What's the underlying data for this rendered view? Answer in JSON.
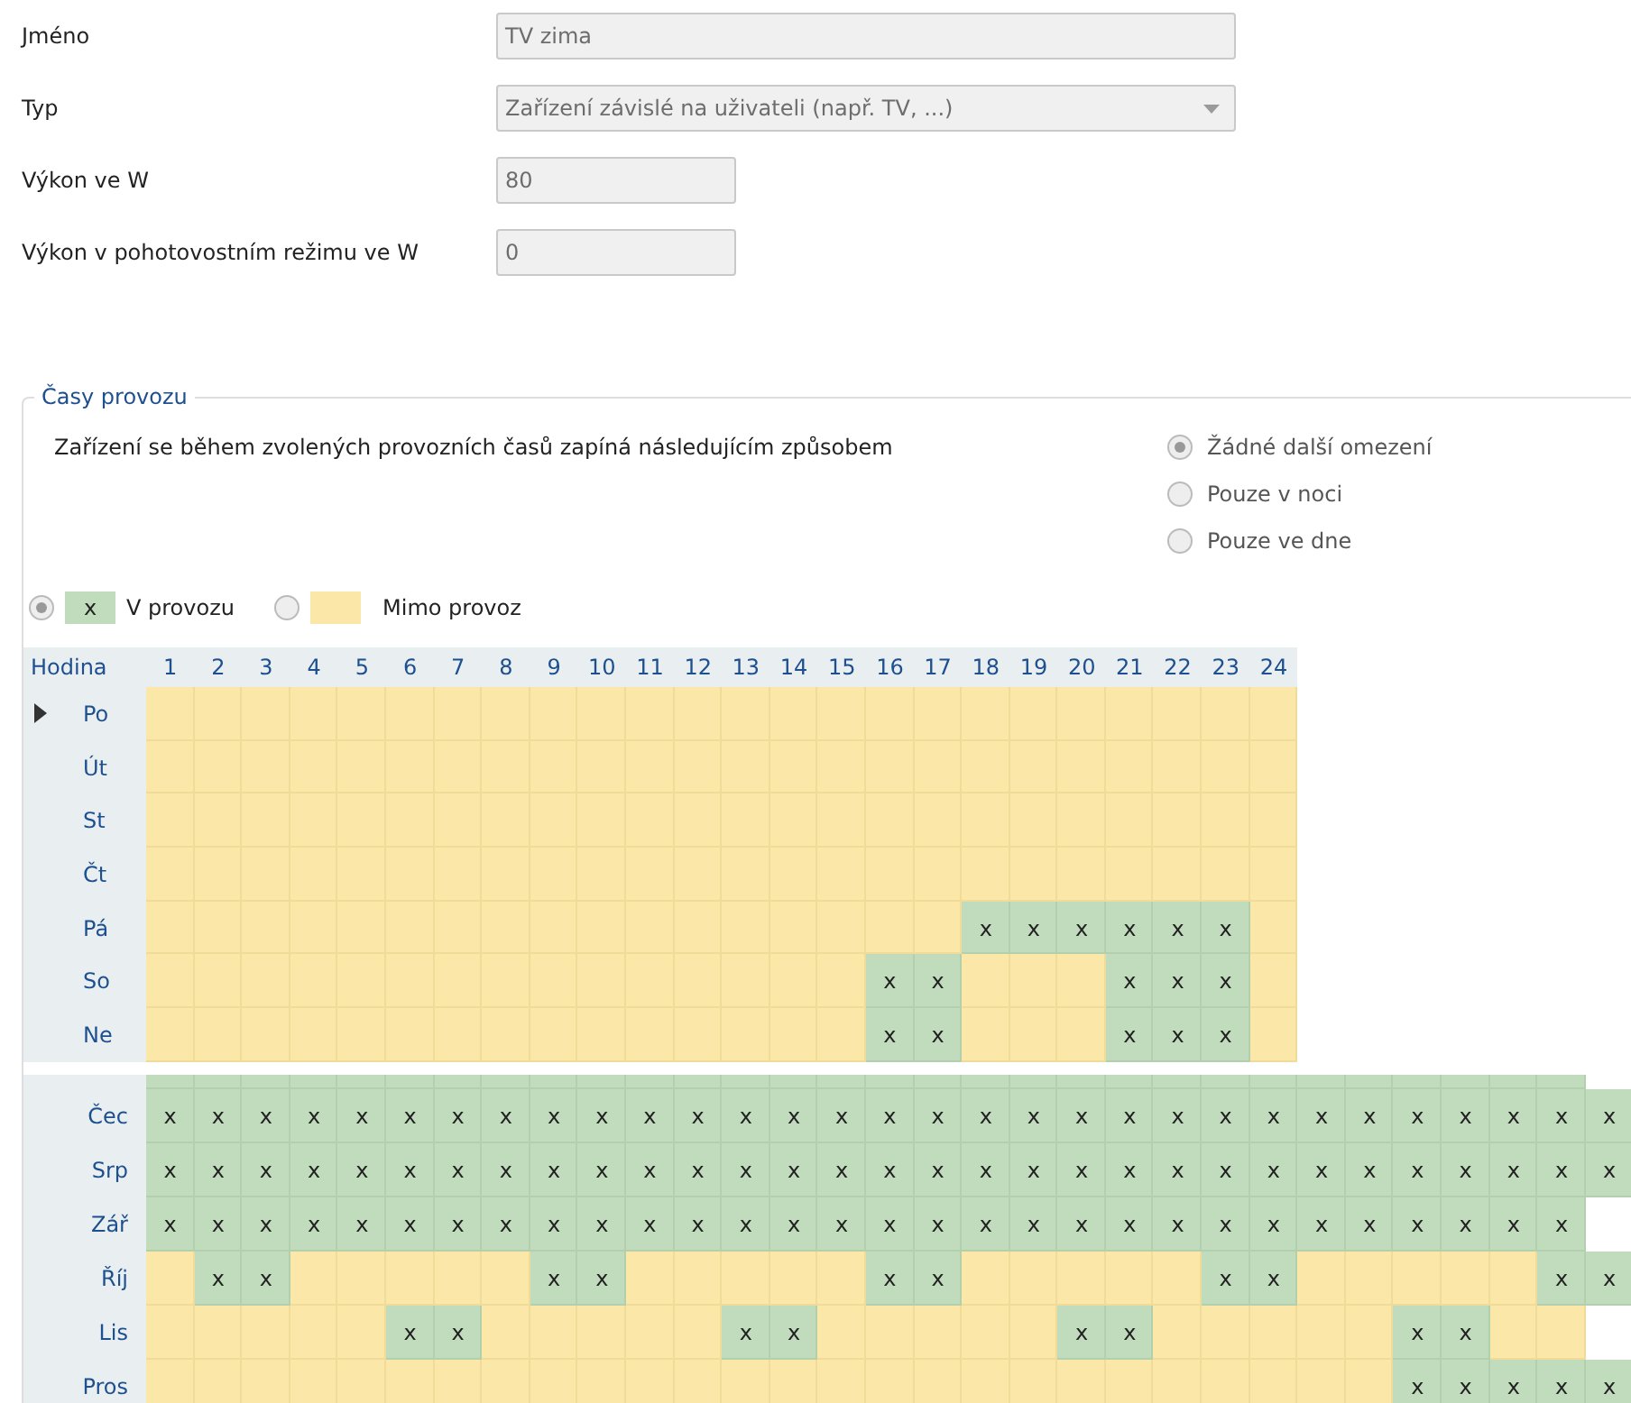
{
  "form": [
    {
      "label": "Jméno",
      "kind": "text",
      "value": "TV zima"
    },
    {
      "label": "Typ",
      "kind": "select",
      "value": "Zařízení závislé na uživateli (např. TV, ...)"
    },
    {
      "label": "Výkon ve W",
      "kind": "number",
      "value": "80"
    },
    {
      "label": "Výkon v pohotovostním režimu ve W",
      "kind": "number",
      "value": "0"
    }
  ],
  "operating_times": {
    "title": "Časy provozu",
    "description": "Zařízení se během zvolených provozních časů zapíná následujícím způsobem",
    "options": [
      {
        "label": "Žádné další omezení",
        "selected": true
      },
      {
        "label": "Pouze v noci",
        "selected": false
      },
      {
        "label": "Pouze ve dne",
        "selected": false
      }
    ],
    "legend": [
      {
        "label": "V provozu",
        "on": true,
        "mark": "x",
        "selected": true
      },
      {
        "label": "Mimo provoz",
        "on": false,
        "selected": false
      }
    ],
    "week_grid": {
      "corner": "Hodina",
      "columns": [
        "1",
        "2",
        "3",
        "4",
        "5",
        "6",
        "7",
        "8",
        "9",
        "10",
        "11",
        "12",
        "13",
        "14",
        "15",
        "16",
        "17",
        "18",
        "19",
        "20",
        "21",
        "22",
        "23",
        "24"
      ],
      "rows": [
        {
          "label": "Po",
          "current": true,
          "cells": [
            {
              "on": false
            },
            {
              "on": false
            },
            {
              "on": false
            },
            {
              "on": false
            },
            {
              "on": false
            },
            {
              "on": false
            },
            {
              "on": false
            },
            {
              "on": false
            },
            {
              "on": false
            },
            {
              "on": false
            },
            {
              "on": false
            },
            {
              "on": false
            },
            {
              "on": false
            },
            {
              "on": false
            },
            {
              "on": false
            },
            {
              "on": false
            },
            {
              "on": false
            },
            {
              "on": false
            },
            {
              "on": false
            },
            {
              "on": false
            },
            {
              "on": false
            },
            {
              "on": false
            },
            {
              "on": false
            },
            {
              "on": false
            }
          ]
        },
        {
          "label": "Út",
          "current": false,
          "cells": [
            {
              "on": false
            },
            {
              "on": false
            },
            {
              "on": false
            },
            {
              "on": false
            },
            {
              "on": false
            },
            {
              "on": false
            },
            {
              "on": false
            },
            {
              "on": false
            },
            {
              "on": false
            },
            {
              "on": false
            },
            {
              "on": false
            },
            {
              "on": false
            },
            {
              "on": false
            },
            {
              "on": false
            },
            {
              "on": false
            },
            {
              "on": false
            },
            {
              "on": false
            },
            {
              "on": false
            },
            {
              "on": false
            },
            {
              "on": false
            },
            {
              "on": false
            },
            {
              "on": false
            },
            {
              "on": false
            },
            {
              "on": false
            }
          ]
        },
        {
          "label": "St",
          "current": false,
          "cells": [
            {
              "on": false
            },
            {
              "on": false
            },
            {
              "on": false
            },
            {
              "on": false
            },
            {
              "on": false
            },
            {
              "on": false
            },
            {
              "on": false
            },
            {
              "on": false
            },
            {
              "on": false
            },
            {
              "on": false
            },
            {
              "on": false
            },
            {
              "on": false
            },
            {
              "on": false
            },
            {
              "on": false
            },
            {
              "on": false
            },
            {
              "on": false
            },
            {
              "on": false
            },
            {
              "on": false
            },
            {
              "on": false
            },
            {
              "on": false
            },
            {
              "on": false
            },
            {
              "on": false
            },
            {
              "on": false
            },
            {
              "on": false
            }
          ]
        },
        {
          "label": "Čt",
          "current": false,
          "cells": [
            {
              "on": false
            },
            {
              "on": false
            },
            {
              "on": false
            },
            {
              "on": false
            },
            {
              "on": false
            },
            {
              "on": false
            },
            {
              "on": false
            },
            {
              "on": false
            },
            {
              "on": false
            },
            {
              "on": false
            },
            {
              "on": false
            },
            {
              "on": false
            },
            {
              "on": false
            },
            {
              "on": false
            },
            {
              "on": false
            },
            {
              "on": false
            },
            {
              "on": false
            },
            {
              "on": false
            },
            {
              "on": false
            },
            {
              "on": false
            },
            {
              "on": false
            },
            {
              "on": false
            },
            {
              "on": false
            },
            {
              "on": false
            }
          ]
        },
        {
          "label": "Pá",
          "current": false,
          "cells": [
            {
              "on": false
            },
            {
              "on": false
            },
            {
              "on": false
            },
            {
              "on": false
            },
            {
              "on": false
            },
            {
              "on": false
            },
            {
              "on": false
            },
            {
              "on": false
            },
            {
              "on": false
            },
            {
              "on": false
            },
            {
              "on": false
            },
            {
              "on": false
            },
            {
              "on": false
            },
            {
              "on": false
            },
            {
              "on": false
            },
            {
              "on": false
            },
            {
              "on": false
            },
            {
              "on": true,
              "mark": "x"
            },
            {
              "on": true,
              "mark": "x"
            },
            {
              "on": true,
              "mark": "x"
            },
            {
              "on": true,
              "mark": "x"
            },
            {
              "on": true,
              "mark": "x"
            },
            {
              "on": true,
              "mark": "x"
            },
            {
              "on": false
            }
          ]
        },
        {
          "label": "So",
          "current": false,
          "cells": [
            {
              "on": false
            },
            {
              "on": false
            },
            {
              "on": false
            },
            {
              "on": false
            },
            {
              "on": false
            },
            {
              "on": false
            },
            {
              "on": false
            },
            {
              "on": false
            },
            {
              "on": false
            },
            {
              "on": false
            },
            {
              "on": false
            },
            {
              "on": false
            },
            {
              "on": false
            },
            {
              "on": false
            },
            {
              "on": false
            },
            {
              "on": true,
              "mark": "x"
            },
            {
              "on": true,
              "mark": "x"
            },
            {
              "on": false
            },
            {
              "on": false
            },
            {
              "on": false
            },
            {
              "on": true,
              "mark": "x"
            },
            {
              "on": true,
              "mark": "x"
            },
            {
              "on": true,
              "mark": "x"
            },
            {
              "on": false
            }
          ]
        },
        {
          "label": "Ne",
          "current": false,
          "cells": [
            {
              "on": false
            },
            {
              "on": false
            },
            {
              "on": false
            },
            {
              "on": false
            },
            {
              "on": false
            },
            {
              "on": false
            },
            {
              "on": false
            },
            {
              "on": false
            },
            {
              "on": false
            },
            {
              "on": false
            },
            {
              "on": false
            },
            {
              "on": false
            },
            {
              "on": false
            },
            {
              "on": false
            },
            {
              "on": false
            },
            {
              "on": true,
              "mark": "x"
            },
            {
              "on": true,
              "mark": "x"
            },
            {
              "on": false
            },
            {
              "on": false
            },
            {
              "on": false
            },
            {
              "on": true,
              "mark": "x"
            },
            {
              "on": true,
              "mark": "x"
            },
            {
              "on": true,
              "mark": "x"
            },
            {
              "on": false
            }
          ]
        }
      ]
    },
    "month_grid": {
      "rows": [
        {
          "cells": [
            {
              "on": true
            },
            {
              "on": true
            },
            {
              "on": true
            },
            {
              "on": true
            },
            {
              "on": true
            },
            {
              "on": true
            },
            {
              "on": true
            },
            {
              "on": true
            },
            {
              "on": true
            },
            {
              "on": true
            },
            {
              "on": true
            },
            {
              "on": true
            },
            {
              "on": true
            },
            {
              "on": true
            },
            {
              "on": true
            },
            {
              "on": true
            },
            {
              "on": true
            },
            {
              "on": true
            },
            {
              "on": true
            },
            {
              "on": true
            },
            {
              "on": true
            },
            {
              "on": true
            },
            {
              "on": true
            },
            {
              "on": true
            },
            {
              "on": true
            },
            {
              "on": true
            },
            {
              "on": true
            },
            {
              "on": true
            },
            {
              "on": true
            },
            {
              "on": true
            }
          ]
        },
        {
          "label": "Čec",
          "cells": [
            {
              "on": true,
              "mark": "x"
            },
            {
              "on": true,
              "mark": "x"
            },
            {
              "on": true,
              "mark": "x"
            },
            {
              "on": true,
              "mark": "x"
            },
            {
              "on": true,
              "mark": "x"
            },
            {
              "on": true,
              "mark": "x"
            },
            {
              "on": true,
              "mark": "x"
            },
            {
              "on": true,
              "mark": "x"
            },
            {
              "on": true,
              "mark": "x"
            },
            {
              "on": true,
              "mark": "x"
            },
            {
              "on": true,
              "mark": "x"
            },
            {
              "on": true,
              "mark": "x"
            },
            {
              "on": true,
              "mark": "x"
            },
            {
              "on": true,
              "mark": "x"
            },
            {
              "on": true,
              "mark": "x"
            },
            {
              "on": true,
              "mark": "x"
            },
            {
              "on": true,
              "mark": "x"
            },
            {
              "on": true,
              "mark": "x"
            },
            {
              "on": true,
              "mark": "x"
            },
            {
              "on": true,
              "mark": "x"
            },
            {
              "on": true,
              "mark": "x"
            },
            {
              "on": true,
              "mark": "x"
            },
            {
              "on": true,
              "mark": "x"
            },
            {
              "on": true,
              "mark": "x"
            },
            {
              "on": true,
              "mark": "x"
            },
            {
              "on": true,
              "mark": "x"
            },
            {
              "on": true,
              "mark": "x"
            },
            {
              "on": true,
              "mark": "x"
            },
            {
              "on": true,
              "mark": "x"
            },
            {
              "on": true,
              "mark": "x"
            },
            {
              "on": true,
              "mark": "x"
            }
          ]
        },
        {
          "label": "Srp",
          "cells": [
            {
              "on": true,
              "mark": "x"
            },
            {
              "on": true,
              "mark": "x"
            },
            {
              "on": true,
              "mark": "x"
            },
            {
              "on": true,
              "mark": "x"
            },
            {
              "on": true,
              "mark": "x"
            },
            {
              "on": true,
              "mark": "x"
            },
            {
              "on": true,
              "mark": "x"
            },
            {
              "on": true,
              "mark": "x"
            },
            {
              "on": true,
              "mark": "x"
            },
            {
              "on": true,
              "mark": "x"
            },
            {
              "on": true,
              "mark": "x"
            },
            {
              "on": true,
              "mark": "x"
            },
            {
              "on": true,
              "mark": "x"
            },
            {
              "on": true,
              "mark": "x"
            },
            {
              "on": true,
              "mark": "x"
            },
            {
              "on": true,
              "mark": "x"
            },
            {
              "on": true,
              "mark": "x"
            },
            {
              "on": true,
              "mark": "x"
            },
            {
              "on": true,
              "mark": "x"
            },
            {
              "on": true,
              "mark": "x"
            },
            {
              "on": true,
              "mark": "x"
            },
            {
              "on": true,
              "mark": "x"
            },
            {
              "on": true,
              "mark": "x"
            },
            {
              "on": true,
              "mark": "x"
            },
            {
              "on": true,
              "mark": "x"
            },
            {
              "on": true,
              "mark": "x"
            },
            {
              "on": true,
              "mark": "x"
            },
            {
              "on": true,
              "mark": "x"
            },
            {
              "on": true,
              "mark": "x"
            },
            {
              "on": true,
              "mark": "x"
            },
            {
              "on": true,
              "mark": "x"
            }
          ]
        },
        {
          "label": "Zář",
          "cells": [
            {
              "on": true,
              "mark": "x"
            },
            {
              "on": true,
              "mark": "x"
            },
            {
              "on": true,
              "mark": "x"
            },
            {
              "on": true,
              "mark": "x"
            },
            {
              "on": true,
              "mark": "x"
            },
            {
              "on": true,
              "mark": "x"
            },
            {
              "on": true,
              "mark": "x"
            },
            {
              "on": true,
              "mark": "x"
            },
            {
              "on": true,
              "mark": "x"
            },
            {
              "on": true,
              "mark": "x"
            },
            {
              "on": true,
              "mark": "x"
            },
            {
              "on": true,
              "mark": "x"
            },
            {
              "on": true,
              "mark": "x"
            },
            {
              "on": true,
              "mark": "x"
            },
            {
              "on": true,
              "mark": "x"
            },
            {
              "on": true,
              "mark": "x"
            },
            {
              "on": true,
              "mark": "x"
            },
            {
              "on": true,
              "mark": "x"
            },
            {
              "on": true,
              "mark": "x"
            },
            {
              "on": true,
              "mark": "x"
            },
            {
              "on": true,
              "mark": "x"
            },
            {
              "on": true,
              "mark": "x"
            },
            {
              "on": true,
              "mark": "x"
            },
            {
              "on": true,
              "mark": "x"
            },
            {
              "on": true,
              "mark": "x"
            },
            {
              "on": true,
              "mark": "x"
            },
            {
              "on": true,
              "mark": "x"
            },
            {
              "on": true,
              "mark": "x"
            },
            {
              "on": true,
              "mark": "x"
            },
            {
              "on": true,
              "mark": "x"
            }
          ]
        },
        {
          "label": "Říj",
          "cells": [
            {
              "on": false
            },
            {
              "on": true,
              "mark": "x"
            },
            {
              "on": true,
              "mark": "x"
            },
            {
              "on": false
            },
            {
              "on": false
            },
            {
              "on": false
            },
            {
              "on": false
            },
            {
              "on": false
            },
            {
              "on": true,
              "mark": "x"
            },
            {
              "on": true,
              "mark": "x"
            },
            {
              "on": false
            },
            {
              "on": false
            },
            {
              "on": false
            },
            {
              "on": false
            },
            {
              "on": false
            },
            {
              "on": true,
              "mark": "x"
            },
            {
              "on": true,
              "mark": "x"
            },
            {
              "on": false
            },
            {
              "on": false
            },
            {
              "on": false
            },
            {
              "on": false
            },
            {
              "on": false
            },
            {
              "on": true,
              "mark": "x"
            },
            {
              "on": true,
              "mark": "x"
            },
            {
              "on": false
            },
            {
              "on": false
            },
            {
              "on": false
            },
            {
              "on": false
            },
            {
              "on": false
            },
            {
              "on": true,
              "mark": "x"
            },
            {
              "on": true,
              "mark": "x"
            }
          ]
        },
        {
          "label": "Lis",
          "cells": [
            {
              "on": false
            },
            {
              "on": false
            },
            {
              "on": false
            },
            {
              "on": false
            },
            {
              "on": false
            },
            {
              "on": true,
              "mark": "x"
            },
            {
              "on": true,
              "mark": "x"
            },
            {
              "on": false
            },
            {
              "on": false
            },
            {
              "on": false
            },
            {
              "on": false
            },
            {
              "on": false
            },
            {
              "on": true,
              "mark": "x"
            },
            {
              "on": true,
              "mark": "x"
            },
            {
              "on": false
            },
            {
              "on": false
            },
            {
              "on": false
            },
            {
              "on": false
            },
            {
              "on": false
            },
            {
              "on": true,
              "mark": "x"
            },
            {
              "on": true,
              "mark": "x"
            },
            {
              "on": false
            },
            {
              "on": false
            },
            {
              "on": false
            },
            {
              "on": false
            },
            {
              "on": false
            },
            {
              "on": true,
              "mark": "x"
            },
            {
              "on": true,
              "mark": "x"
            },
            {
              "on": false
            },
            {
              "on": false
            }
          ]
        },
        {
          "label": "Pros",
          "cells": [
            {
              "on": false
            },
            {
              "on": false
            },
            {
              "on": false
            },
            {
              "on": false
            },
            {
              "on": false
            },
            {
              "on": false
            },
            {
              "on": false
            },
            {
              "on": false
            },
            {
              "on": false
            },
            {
              "on": false
            },
            {
              "on": false
            },
            {
              "on": false
            },
            {
              "on": false
            },
            {
              "on": false
            },
            {
              "on": false
            },
            {
              "on": false
            },
            {
              "on": false
            },
            {
              "on": false
            },
            {
              "on": false
            },
            {
              "on": false
            },
            {
              "on": false
            },
            {
              "on": false
            },
            {
              "on": false
            },
            {
              "on": false
            },
            {
              "on": false
            },
            {
              "on": false
            },
            {
              "on": true,
              "mark": "x"
            },
            {
              "on": true,
              "mark": "x"
            },
            {
              "on": true,
              "mark": "x"
            },
            {
              "on": true,
              "mark": "x"
            },
            {
              "on": true,
              "mark": "x"
            }
          ]
        }
      ]
    }
  }
}
